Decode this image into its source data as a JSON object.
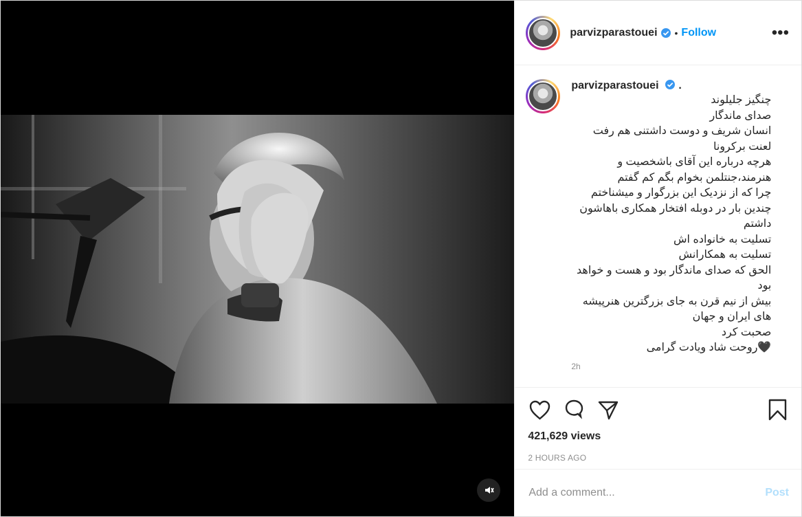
{
  "post": {
    "username": "parvizparastouei",
    "follow_label": "Follow",
    "more_label": "•••",
    "caption_suffix": ".",
    "caption_text": "چنگیز جلیلوند\nصدای ماندگار\nانسان شریف و دوست داشتنی هم رفت\nلعنت برکرونا\nهرچه درباره این آقای باشخصیت و هنرمند،جنتلمن بخوام بگم کم گفتم\nچرا که از نزدیک این بزرگوار و میشناختم\nچندین بار در دوبله افتخار همکاری باهاشون داشتم\nتسلیت به خانواده اش\nتسلیت به همکارانش\nالحق که صدای ماندگار بود و هست و خواهد بود\nبیش از نیم قرن به جای بزرگترین هنرپیشه های ایران و جهان\nصحبت کرد\n🖤روحت شاد ویادت گرامی",
    "time_ago": "2h",
    "views": "421,629 views",
    "posted": "2 HOURS AGO"
  },
  "comment": {
    "placeholder": "Add a comment...",
    "post_label": "Post"
  },
  "icons": {
    "verified": "verified-icon",
    "like": "heart-icon",
    "comment": "comment-icon",
    "share": "share-icon",
    "save": "bookmark-icon",
    "audio": "mute-icon"
  },
  "colors": {
    "accent": "#0095f6",
    "post_disabled": "#b2dffc",
    "verified": "#3897f0"
  }
}
